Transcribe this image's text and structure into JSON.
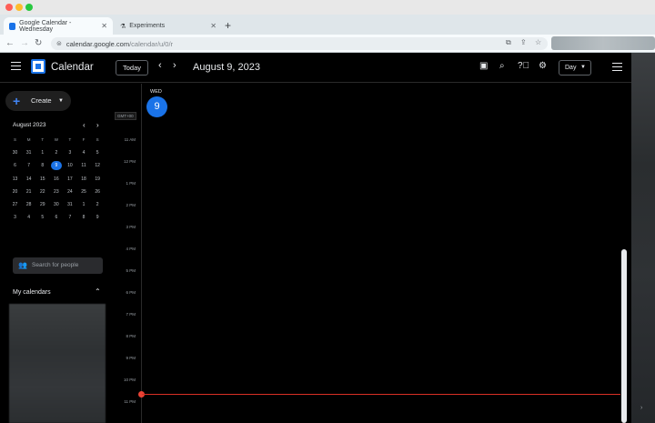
{
  "browser": {
    "tabs": [
      {
        "title": "Google Calendar - Wednesday",
        "active": true
      },
      {
        "title": "Experiments",
        "active": false
      }
    ],
    "new_tab": "+",
    "url_host": "calendar.google.com",
    "url_path": "/calendar/u/0/r"
  },
  "app": {
    "title": "Calendar",
    "today_button": "Today",
    "date_label": "August 9, 2023",
    "view_select": "Day"
  },
  "sidebar": {
    "create_label": "Create",
    "mini_month": "August 2023",
    "weekday_headers": [
      "S",
      "M",
      "T",
      "W",
      "T",
      "F",
      "S"
    ],
    "weeks": [
      [
        "30",
        "31",
        "1",
        "2",
        "3",
        "4",
        "5"
      ],
      [
        "6",
        "7",
        "8",
        "9",
        "10",
        "11",
        "12"
      ],
      [
        "13",
        "14",
        "15",
        "16",
        "17",
        "18",
        "19"
      ],
      [
        "20",
        "21",
        "22",
        "23",
        "24",
        "25",
        "26"
      ],
      [
        "27",
        "28",
        "29",
        "30",
        "31",
        "1",
        "2"
      ],
      [
        "3",
        "4",
        "5",
        "6",
        "7",
        "8",
        "9"
      ]
    ],
    "selected_day": "9",
    "search_people_placeholder": "Search for people",
    "my_calendars": "My calendars"
  },
  "day_view": {
    "weekday": "WED",
    "day_number": "9",
    "timezone": "GMT+00",
    "hours": [
      "11 AM",
      "12 PM",
      "1 PM",
      "2 PM",
      "3 PM",
      "4 PM",
      "5 PM",
      "6 PM",
      "7 PM",
      "8 PM",
      "9 PM",
      "10 PM",
      "11 PM"
    ]
  },
  "colors": {
    "accent": "#1a73e8",
    "now_line": "#d93025",
    "background": "#000000"
  }
}
